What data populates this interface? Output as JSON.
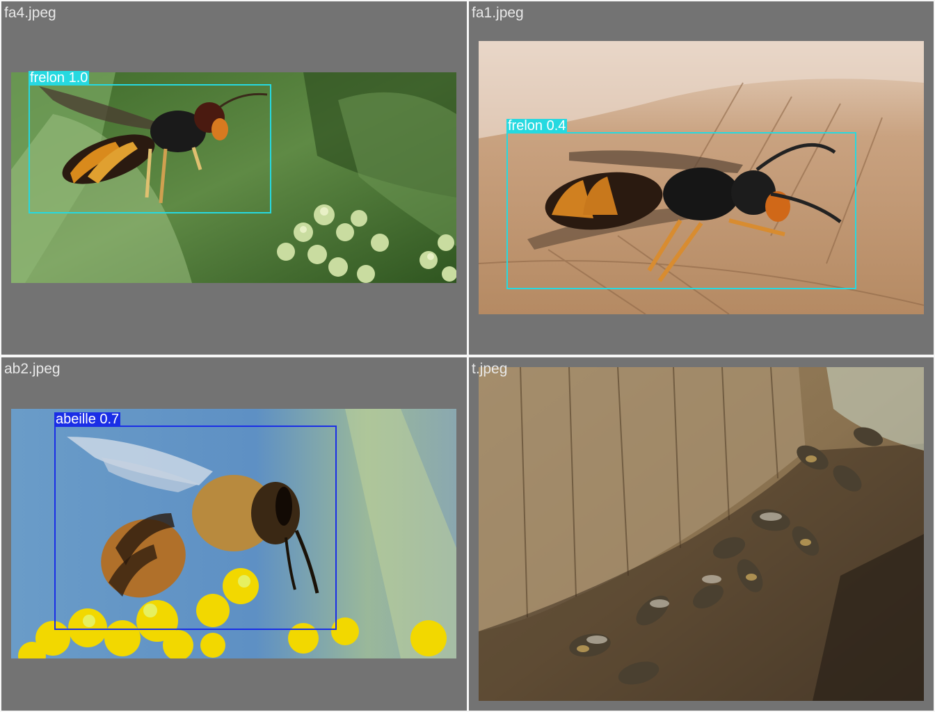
{
  "colors": {
    "panel_bg": "#737373",
    "grid_line": "#f7f7f7",
    "frelon_box": "#26d9e0",
    "abeille_box": "#1a2ee6"
  },
  "panels": [
    {
      "title": "fa4.jpeg",
      "detections": [
        {
          "label": "frelon 1.0",
          "class": "frelon",
          "confidence": 1.0
        }
      ]
    },
    {
      "title": "fa1.jpeg",
      "detections": [
        {
          "label": "frelon 0.4",
          "class": "frelon",
          "confidence": 0.4
        }
      ]
    },
    {
      "title": "ab2.jpeg",
      "detections": [
        {
          "label": "abeille 0.7",
          "class": "abeille",
          "confidence": 0.7
        }
      ]
    },
    {
      "title": "t.jpeg",
      "detections": []
    }
  ]
}
